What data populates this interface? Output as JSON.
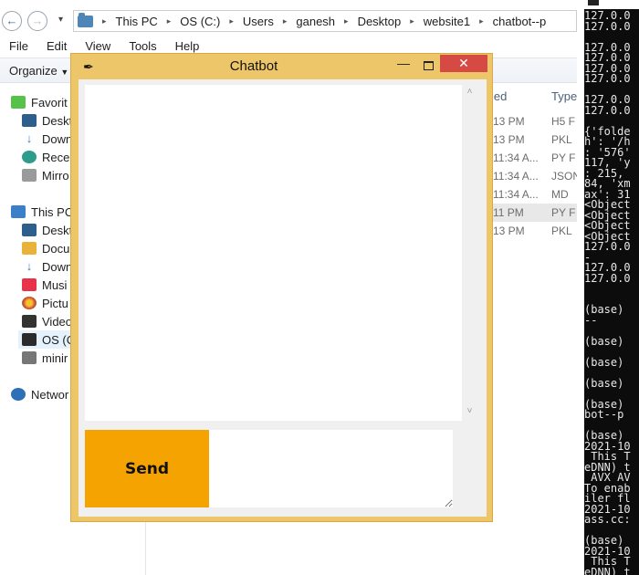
{
  "explorer": {
    "breadcrumbs": [
      "This PC",
      "OS (C:)",
      "Users",
      "ganesh",
      "Desktop",
      "website1",
      "chatbot--p"
    ],
    "menu": [
      "File",
      "Edit",
      "View",
      "Tools",
      "Help"
    ],
    "organize_label": "Organize",
    "nav": {
      "favorites": "Favorit",
      "fav_items": [
        "Deskt",
        "Down",
        "Recer",
        "Mirro"
      ],
      "this_pc": "This PC",
      "pc_items": [
        "Deskt",
        "Docu",
        "Down",
        "Musi",
        "Pictu",
        "Video",
        "OS (C",
        "minir"
      ],
      "network": "Networ"
    },
    "columns": {
      "modified": "ied",
      "type": "Type"
    },
    "rows": [
      {
        "time": "13 PM",
        "type": "H5 F"
      },
      {
        "time": "13 PM",
        "type": "PKL"
      },
      {
        "time": "11:34 A...",
        "type": "PY F"
      },
      {
        "time": "11:34 A...",
        "type": "JSON"
      },
      {
        "time": "11:34 A...",
        "type": "MD"
      },
      {
        "time": "11 PM",
        "type": "PY F"
      },
      {
        "time": "13 PM",
        "type": "PKL"
      }
    ]
  },
  "console_text": "127.0.0\n127.0.0\n\n127.0.0\n127.0.0\n127.0.0\n127.0.0\n\n127.0.0\n127.0.0\n\n{'folde\nh': '/h\n: '576'\n117, 'y\n: 215,\n84, 'xm\nax': 31\n<Object\n<Object\n<Object\n<Object\n127.0.0\n-\n127.0.0\n127.0.0\n\n\n(base)\n--\n\n(base)\n\n(base)\n\n(base)\n\n(base)\nbot--p\n\n(base)\n2021-10\n This T\neDNN) t\n AVX AV\nTo enab\niler fl\n2021-10\nass.cc:\n\n(base)\n2021-10\n This T\neDNN) t",
  "chatbot": {
    "title": "Chatbot",
    "send_label": "Send",
    "min_glyph": "—",
    "close_glyph": "✕",
    "feather_glyph": "✒",
    "colors": {
      "frame": "#eec66a",
      "send": "#f5a300",
      "close": "#d54a43"
    }
  }
}
